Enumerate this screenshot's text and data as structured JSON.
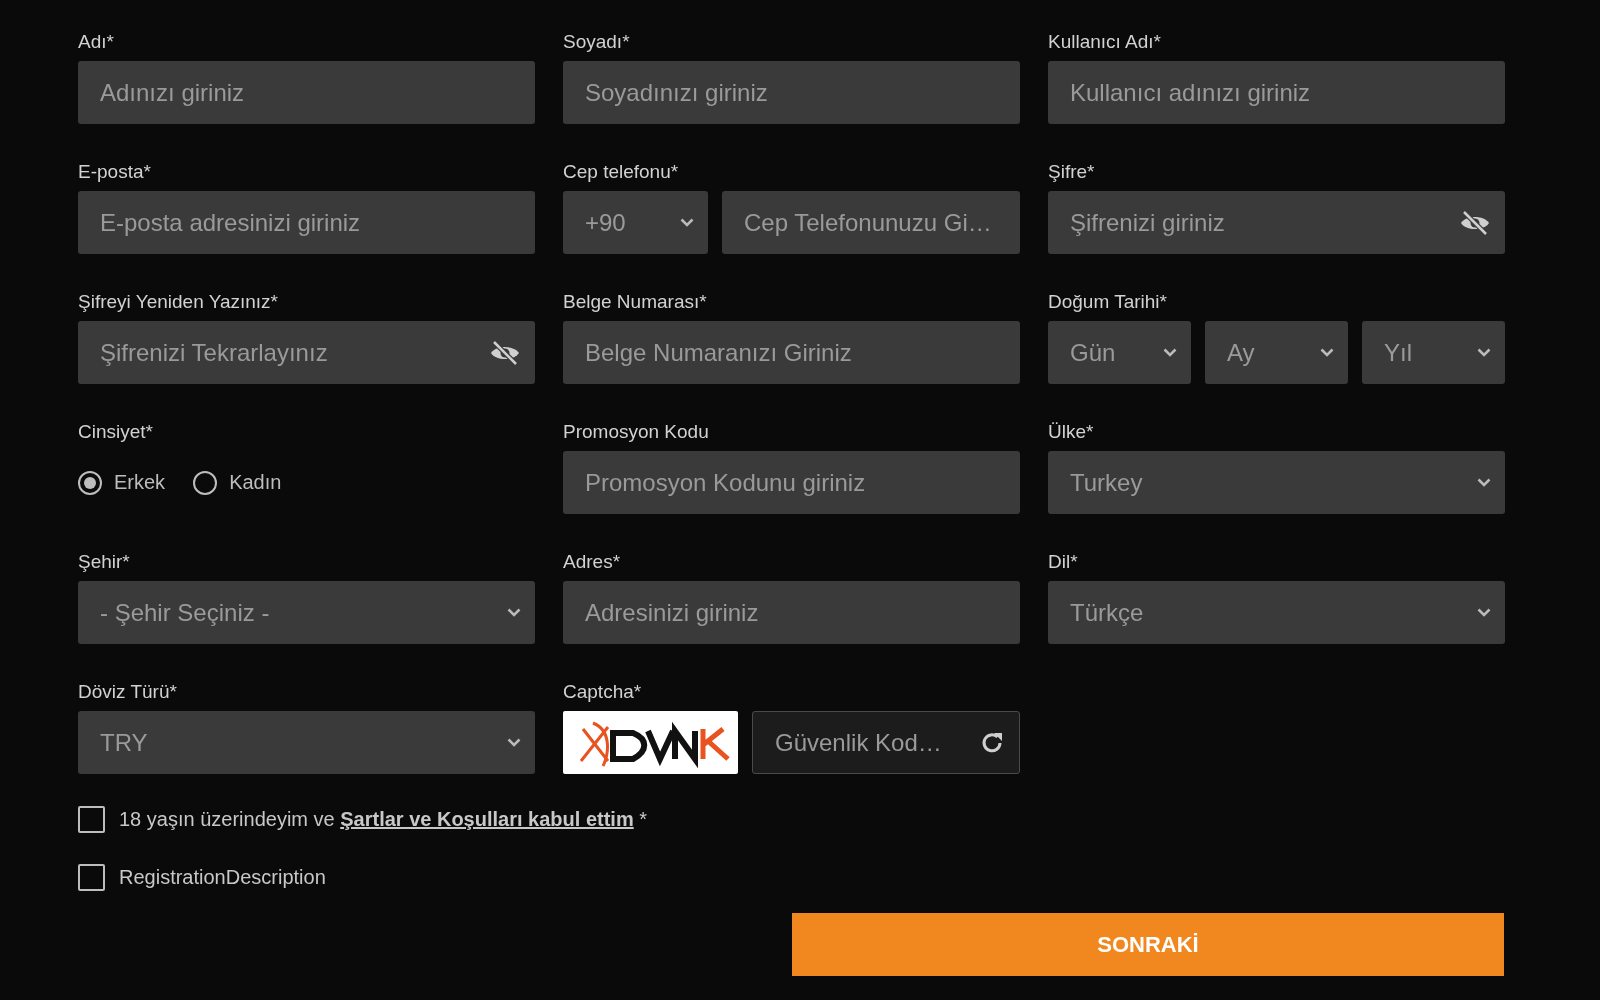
{
  "fields": [
    {
      "kind": "text",
      "label": "Adı*",
      "placeholder": "Adınızı giriniz"
    },
    {
      "kind": "text",
      "label": "Soyadı*",
      "placeholder": "Soyadınızı giriniz"
    },
    {
      "kind": "text",
      "label": "Kullanıcı Adı*",
      "placeholder": "Kullanıcı adınızı giriniz"
    },
    {
      "kind": "text",
      "label": "E-posta*",
      "placeholder": "E-posta adresinizi giriniz"
    },
    {
      "kind": "phone",
      "label": "Cep telefonu*",
      "code": "+90",
      "placeholder": "Cep Telefonunuzu Gi…"
    },
    {
      "kind": "password",
      "label": "Şifre*",
      "placeholder": "Şifrenizi giriniz"
    },
    {
      "kind": "password",
      "label": "Şifreyi Yeniden Yazınız*",
      "placeholder": "Şifrenizi Tekrarlayınız"
    },
    {
      "kind": "text",
      "label": "Belge Numarası*",
      "placeholder": "Belge Numaranızı Giriniz"
    },
    {
      "kind": "date",
      "label": "Doğum Tarihi*",
      "parts": [
        "Gün",
        "Ay",
        "Yıl"
      ]
    },
    {
      "kind": "radio",
      "label": "Cinsiyet*",
      "options": [
        {
          "label": "Erkek",
          "selected": true
        },
        {
          "label": "Kadın",
          "selected": false
        }
      ]
    },
    {
      "kind": "text",
      "label": "Promosyon Kodu",
      "placeholder": "Promosyon Kodunu giriniz"
    },
    {
      "kind": "select",
      "label": "Ülke*",
      "value": "Turkey"
    },
    {
      "kind": "select",
      "label": "Şehir*",
      "value": "- Şehir Seçiniz -"
    },
    {
      "kind": "text",
      "label": "Adres*",
      "placeholder": "Adresinizi giriniz"
    },
    {
      "kind": "select",
      "label": "Dil*",
      "value": "Türkçe"
    },
    {
      "kind": "select",
      "label": "Döviz Türü*",
      "value": "TRY"
    },
    {
      "kind": "captcha",
      "label": "Captcha*",
      "placeholder": "Güvenlik Kod…"
    }
  ],
  "agreements": [
    {
      "text": "18 yaşın üzerindeyim ve ",
      "link": "Şartlar ve Koşulları kabul ettim",
      "suffix": " *",
      "checked": false
    },
    {
      "text": "RegistrationDescription",
      "checked": false
    }
  ],
  "submit": "SONRAKİ"
}
